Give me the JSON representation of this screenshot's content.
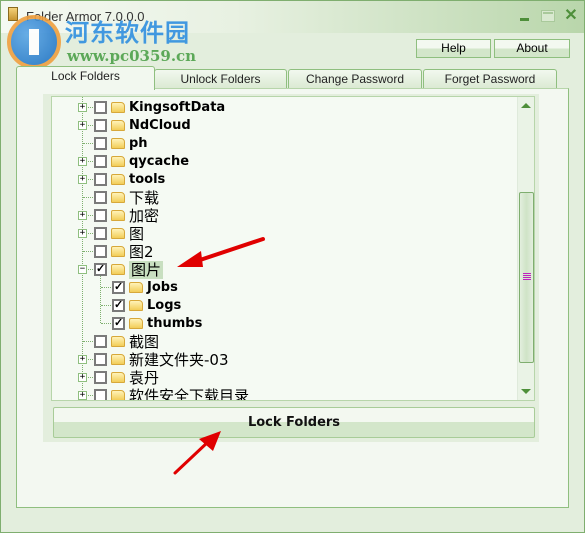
{
  "window": {
    "title": "Folder Armor 7.0.0.0",
    "controls": {
      "minimize": "minimize",
      "maximize": "maximize",
      "close": "✕"
    }
  },
  "watermark": {
    "site_name": "河东软件园",
    "url": "www.pc0359.cn"
  },
  "toolbar": {
    "help_label": "Help",
    "about_label": "About"
  },
  "tabs": [
    {
      "label": "Lock Folders",
      "active": true
    },
    {
      "label": "Unlock Folders",
      "active": false
    },
    {
      "label": "Change Password",
      "active": false
    },
    {
      "label": "Forget Password",
      "active": false
    }
  ],
  "tree": {
    "items": [
      {
        "label": "KingsoftData",
        "level": 0,
        "expander": "+",
        "checked": false
      },
      {
        "label": "NdCloud",
        "level": 0,
        "expander": "+",
        "checked": false
      },
      {
        "label": "ph",
        "level": 0,
        "expander": "",
        "checked": false
      },
      {
        "label": "qycache",
        "level": 0,
        "expander": "+",
        "checked": false
      },
      {
        "label": "tools",
        "level": 0,
        "expander": "+",
        "checked": false
      },
      {
        "label": "下载",
        "level": 0,
        "expander": "",
        "checked": false
      },
      {
        "label": "加密",
        "level": 0,
        "expander": "+",
        "checked": false
      },
      {
        "label": "图",
        "level": 0,
        "expander": "+",
        "checked": false
      },
      {
        "label": "图2",
        "level": 0,
        "expander": "",
        "checked": false
      },
      {
        "label": "图片",
        "level": 0,
        "expander": "−",
        "checked": true,
        "selected": true
      },
      {
        "label": "Jobs",
        "level": 1,
        "expander": "",
        "checked": true
      },
      {
        "label": "Logs",
        "level": 1,
        "expander": "",
        "checked": true
      },
      {
        "label": "thumbs",
        "level": 1,
        "expander": "",
        "checked": true
      },
      {
        "label": "截图",
        "level": 0,
        "expander": "",
        "checked": false
      },
      {
        "label": "新建文件夹-03",
        "level": 0,
        "expander": "+",
        "checked": false
      },
      {
        "label": "袁丹",
        "level": 0,
        "expander": "+",
        "checked": false
      },
      {
        "label": "软件安全下载目录",
        "level": 0,
        "expander": "+",
        "checked": false
      }
    ]
  },
  "actions": {
    "lock_folders_label": "Lock Folders"
  },
  "colors": {
    "window_bg": "#e3eedd",
    "accent_green": "#7fae6f",
    "annotation_red": "#e00000"
  }
}
